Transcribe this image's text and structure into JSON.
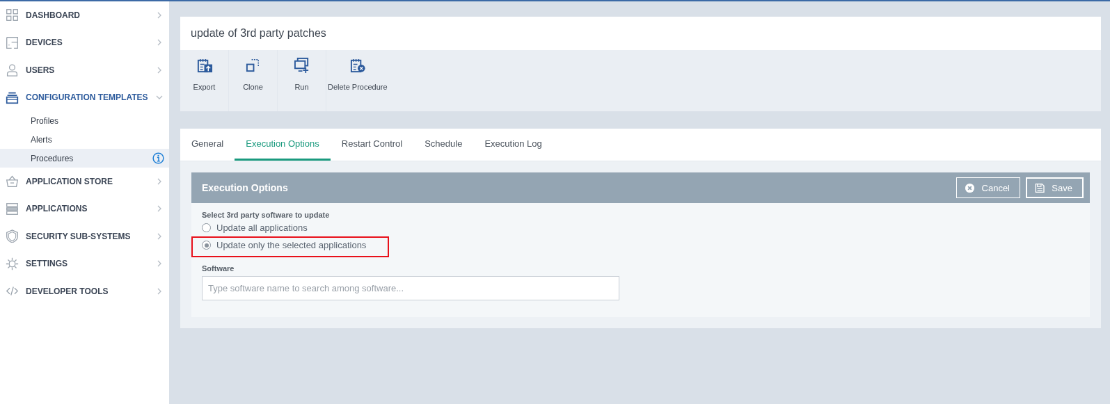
{
  "sidebar": {
    "items": [
      {
        "label": "DASHBOARD",
        "expanded": false,
        "active": false
      },
      {
        "label": "DEVICES",
        "expanded": false,
        "active": false
      },
      {
        "label": "USERS",
        "expanded": false,
        "active": false
      },
      {
        "label": "CONFIGURATION TEMPLATES",
        "expanded": true,
        "active": true,
        "children": [
          {
            "label": "Profiles",
            "selected": false
          },
          {
            "label": "Alerts",
            "selected": false
          },
          {
            "label": "Procedures",
            "selected": true
          }
        ]
      },
      {
        "label": "APPLICATION STORE",
        "expanded": false,
        "active": false
      },
      {
        "label": "APPLICATIONS",
        "expanded": false,
        "active": false
      },
      {
        "label": "SECURITY SUB-SYSTEMS",
        "expanded": false,
        "active": false
      },
      {
        "label": "SETTINGS",
        "expanded": false,
        "active": false
      },
      {
        "label": "DEVELOPER TOOLS",
        "expanded": false,
        "active": false
      }
    ]
  },
  "page": {
    "title": "update of 3rd party patches",
    "toolbar": [
      {
        "label": "Export"
      },
      {
        "label": "Clone"
      },
      {
        "label": "Run"
      },
      {
        "label": "Delete Procedure"
      }
    ]
  },
  "tabs": [
    {
      "label": "General",
      "selected": false
    },
    {
      "label": "Execution Options",
      "selected": true
    },
    {
      "label": "Restart Control",
      "selected": false
    },
    {
      "label": "Schedule",
      "selected": false
    },
    {
      "label": "Execution Log",
      "selected": false
    }
  ],
  "panel": {
    "title": "Execution Options",
    "buttons": [
      {
        "label": "Cancel"
      },
      {
        "label": "Save"
      }
    ],
    "group_label": "Select 3rd party software to update",
    "options": [
      {
        "label": "Update all applications",
        "selected": false,
        "highlighted": false
      },
      {
        "label": "Update only the selected applications",
        "selected": true,
        "highlighted": true
      }
    ],
    "software": {
      "label": "Software",
      "placeholder": "Type software name to search among software..."
    }
  }
}
